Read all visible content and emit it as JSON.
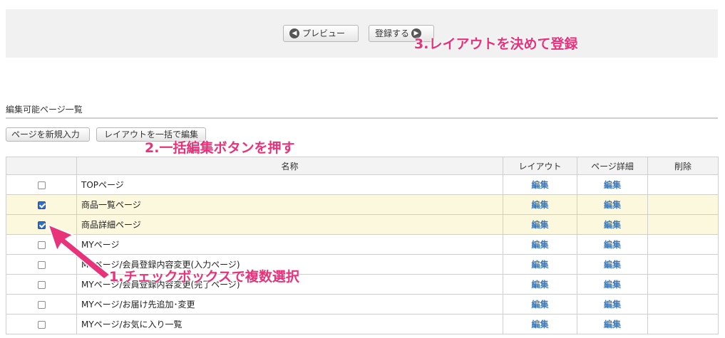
{
  "toolbar": {
    "preview_label": "プレビュー",
    "preview_icon": "arrow-left-circle-icon",
    "register_label": "登録する",
    "register_icon": "arrow-right-circle-icon"
  },
  "section": {
    "title": "編集可能ページ一覧",
    "new_page_button": "ページを新規入力",
    "bulk_layout_button": "レイアウトを一括で編集"
  },
  "table": {
    "headers": [
      "",
      "名称",
      "レイアウト",
      "ページ詳細",
      "削除"
    ],
    "rows": [
      {
        "checked": false,
        "name": "TOPページ",
        "layout": "編集",
        "detail": "編集",
        "delete": ""
      },
      {
        "checked": true,
        "name": "商品一覧ページ",
        "layout": "編集",
        "detail": "編集",
        "delete": ""
      },
      {
        "checked": true,
        "name": "商品詳細ページ",
        "layout": "編集",
        "detail": "編集",
        "delete": ""
      },
      {
        "checked": false,
        "name": "MYページ",
        "layout": "編集",
        "detail": "編集",
        "delete": ""
      },
      {
        "checked": false,
        "name": "MYページ/会員登録内容変更(入力ページ)",
        "layout": "編集",
        "detail": "編集",
        "delete": ""
      },
      {
        "checked": false,
        "name": "MYページ/会員登録内容変更(完了ページ)",
        "layout": "編集",
        "detail": "編集",
        "delete": ""
      },
      {
        "checked": false,
        "name": "MYページ/お届け先追加･変更",
        "layout": "編集",
        "detail": "編集",
        "delete": ""
      },
      {
        "checked": false,
        "name": "MYページ/お気に入り一覧",
        "layout": "編集",
        "detail": "編集",
        "delete": ""
      }
    ]
  },
  "annotations": {
    "step1": "1.チェックボックスで複数選択",
    "step2": "2.一括編集ボタンを押す",
    "step3": "3.レイアウトを決めて登録",
    "color": "#e8327a"
  },
  "colors": {
    "selected_row_bg": "#fbf8dd",
    "link": "#3d7ab8",
    "toolbar_bg": "#f1f1f1"
  }
}
